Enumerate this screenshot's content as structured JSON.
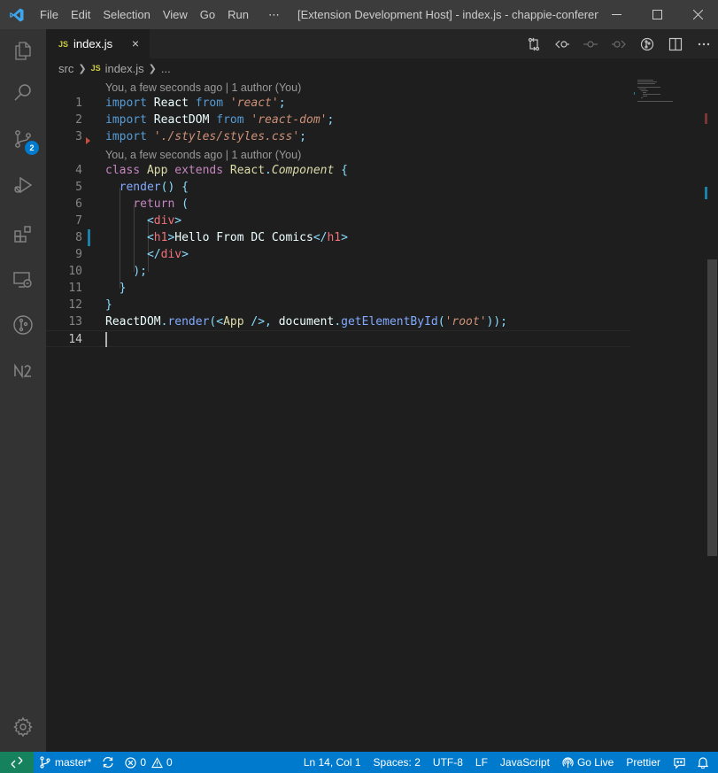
{
  "window": {
    "title": "[Extension Development Host] - index.js - chappie-conferenc...",
    "menu": [
      "File",
      "Edit",
      "Selection",
      "View",
      "Go",
      "Run",
      "⋯"
    ]
  },
  "activity": {
    "scm_badge": "2"
  },
  "tab": {
    "icon": "JS",
    "label": "index.js",
    "close": "×"
  },
  "breadcrumb": {
    "folder": "src",
    "icon": "JS",
    "file": "index.js",
    "more": "..."
  },
  "codelens": {
    "first": "You, a few seconds ago | 1 author (You)",
    "second": "You, a few seconds ago | 1 author (You)"
  },
  "line_numbers": [
    "1",
    "2",
    "3",
    "4",
    "5",
    "6",
    "7",
    "8",
    "9",
    "10",
    "11",
    "12",
    "13",
    "14"
  ],
  "code": {
    "l1": [
      "import",
      " React ",
      "from",
      " ",
      "'react'",
      ";"
    ],
    "l2": [
      "import",
      " ReactDOM ",
      "from",
      " ",
      "'react-dom'",
      ";"
    ],
    "l3": [
      "import",
      " ",
      "'./styles/styles.css'",
      ";"
    ],
    "l4": [
      "class",
      " ",
      "App",
      " ",
      "extends",
      " ",
      "React",
      ".",
      "Component",
      " ",
      "{"
    ],
    "l5": [
      "  ",
      "render",
      "() {"
    ],
    "l6": [
      "    ",
      "return",
      " ("
    ],
    "l7": [
      "      ",
      "<",
      "div",
      ">"
    ],
    "l8": [
      "      ",
      "<",
      "h1",
      ">",
      "Hello From DC Comics",
      "</",
      "h1",
      ">"
    ],
    "l9": [
      "      ",
      "</",
      "div",
      ">"
    ],
    "l10": [
      "    ",
      ");"
    ],
    "l11": [
      "  ",
      "}"
    ],
    "l12": [
      "}"
    ],
    "l13": [
      "ReactDOM",
      ".",
      "render",
      "(",
      "<",
      "App",
      " />",
      ", ",
      "document",
      ".",
      "getElementById",
      "(",
      "'root'",
      "));"
    ],
    "l14": [
      ""
    ]
  },
  "status": {
    "branch": "master*",
    "errors": "0",
    "warnings": "0",
    "position": "Ln 14, Col 1",
    "spaces": "Spaces: 2",
    "encoding": "UTF-8",
    "eol": "LF",
    "language": "JavaScript",
    "golive": "Go Live",
    "prettier": "Prettier"
  },
  "colors": {
    "statusbar": "#007acc",
    "titlebar": "#3c3c3c",
    "activitybar": "#333333",
    "editor": "#1e1e1e"
  },
  "icons": [
    "vscode-logo-icon",
    "explorer-icon",
    "search-icon",
    "source-control-icon",
    "run-debug-icon",
    "extensions-icon",
    "remote-explorer-icon",
    "git-graph-icon",
    "nx-console-icon",
    "settings-gear-icon"
  ]
}
